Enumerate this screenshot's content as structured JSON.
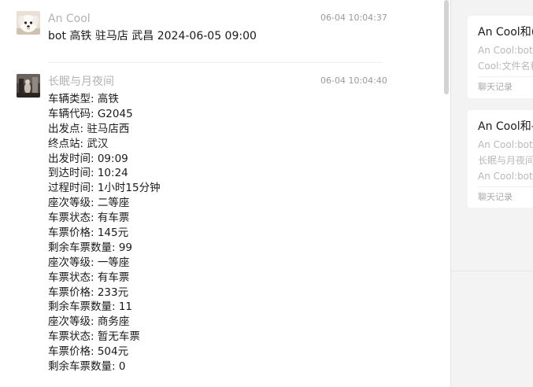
{
  "messages": [
    {
      "sender": "An Cool",
      "time": "06-04 10:04:37",
      "text": "bot 高铁 驻马店 武昌 2024-06-05 09:00",
      "avatar": "white-dog-avatar"
    },
    {
      "sender": "长眠与月夜间",
      "time": "06-04 10:04:40",
      "avatar": "dark-scene-avatar",
      "lines": [
        "车辆类型: 高铁",
        "车辆代码: G2045",
        "出发点: 驻马店西",
        "终点站: 武汉",
        "出发时间: 09:09",
        "到达时间: 10:24",
        "过程时间: 1小时15分钟",
        "座次等级: 二等座",
        "车票状态: 有车票",
        "车票价格: 145元",
        "剩余车票数量: 99",
        "座次等级: 一等座",
        "车票状态: 有车票",
        "车票价格: 233元",
        "剩余车票数量: 11",
        "座次等级: 商务座",
        "车票状态: 暂无车票",
        "车票价格: 504元",
        "剩余车票数量: 0"
      ]
    }
  ],
  "side_cards": [
    {
      "title": "An Cool和(",
      "lines": [
        "An Cool:bot",
        "Cool:文件名称"
      ],
      "footer": "聊天记录"
    },
    {
      "title": "An Cool和-",
      "lines": [
        "An Cool:bot",
        "长眠与月夜间",
        "An Cool:bot"
      ],
      "footer": "聊天记录"
    }
  ],
  "colors": {
    "side_background": "#f3f3f3",
    "meta_text": "#b2b2b2",
    "body_text": "#1a1a1a"
  }
}
